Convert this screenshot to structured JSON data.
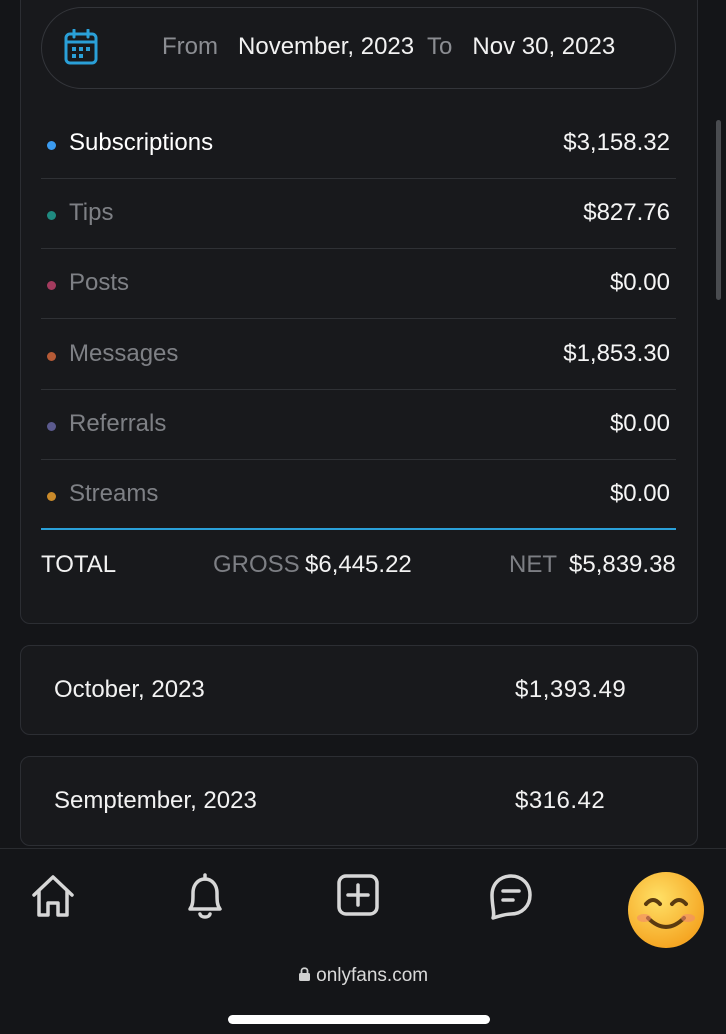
{
  "date_filter": {
    "from_label": "From",
    "from_value": "November, 2023",
    "to_label": "To",
    "to_value": "Nov 30, 2023"
  },
  "categories": [
    {
      "label": "Subscriptions",
      "value": "$3,158.32",
      "dot_color": "#3b9bf0",
      "label_color": "#ffffff"
    },
    {
      "label": "Tips",
      "value": "$827.76",
      "dot_color": "#1f8a80",
      "label_color": "#7e8085"
    },
    {
      "label": "Posts",
      "value": "$0.00",
      "dot_color": "#a33b5e",
      "label_color": "#7e8085"
    },
    {
      "label": "Messages",
      "value": "$1,853.30",
      "dot_color": "#b55a36",
      "label_color": "#7e8085"
    },
    {
      "label": "Referrals",
      "value": "$0.00",
      "dot_color": "#5b5a8e",
      "label_color": "#7e8085"
    },
    {
      "label": "Streams",
      "value": "$0.00",
      "dot_color": "#c98a2a",
      "label_color": "#7e8085"
    }
  ],
  "total": {
    "label": "TOTAL",
    "gross_label": "GROSS",
    "gross_value": "$6,445.22",
    "net_label": "NET",
    "net_value": "$5,839.38"
  },
  "months": [
    {
      "label": "October, 2023",
      "value": "$1,393.49"
    },
    {
      "label": "Semptember, 2023",
      "value": "$316.42"
    }
  ],
  "nav": {
    "icons": [
      "home-icon",
      "bell-icon",
      "add-post-icon",
      "messages-icon",
      "avatar-emoji"
    ]
  },
  "browser": {
    "url": "onlyfans.com"
  },
  "colors": {
    "accent": "#2aa0d8",
    "background": "#141518"
  }
}
